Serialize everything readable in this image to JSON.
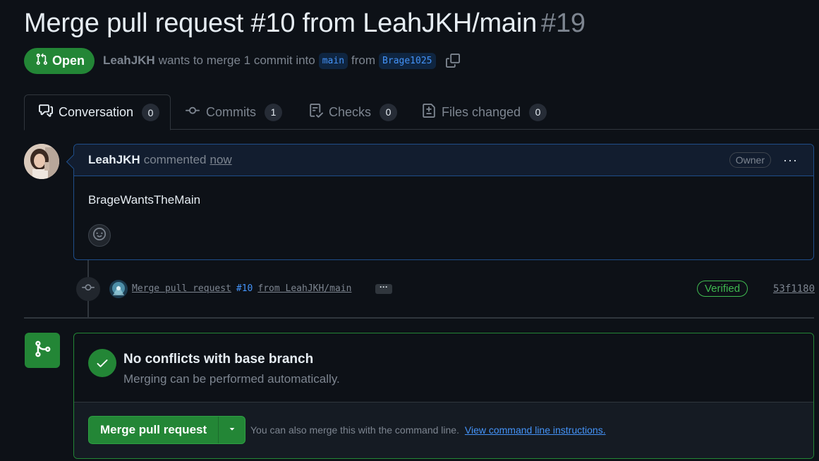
{
  "pr": {
    "title": "Merge pull request #10 from LeahJKH/main",
    "number": "#19",
    "state": "Open",
    "author": "LeahJKH",
    "merge_text": "wants to merge 1 commit into",
    "base_branch": "main",
    "from_text": "from",
    "head_branch": "Brage1025"
  },
  "tabs": [
    {
      "label": "Conversation",
      "count": "0"
    },
    {
      "label": "Commits",
      "count": "1"
    },
    {
      "label": "Checks",
      "count": "0"
    },
    {
      "label": "Files changed",
      "count": "0"
    }
  ],
  "comment": {
    "author": "LeahJKH",
    "verb": "commented",
    "time": "now",
    "badge": "Owner",
    "menu": "···",
    "body": "BrageWantsTheMain"
  },
  "commit": {
    "msg_prefix": "Merge pull request",
    "pr_link": "#10",
    "msg_suffix": "from LeahJKH/main",
    "more": "···",
    "verified": "Verified",
    "sha": "53f1180"
  },
  "merge": {
    "status_title": "No conflicts with base branch",
    "status_sub": "Merging can be performed automatically.",
    "button_label": "Merge pull request",
    "hint": "You can also merge this with the command line.",
    "hint_link": "View command line instructions."
  },
  "colors": {
    "open_green": "#238636",
    "link_blue": "#4493f8",
    "muted": "#7d8590",
    "bg": "#0d1117"
  }
}
